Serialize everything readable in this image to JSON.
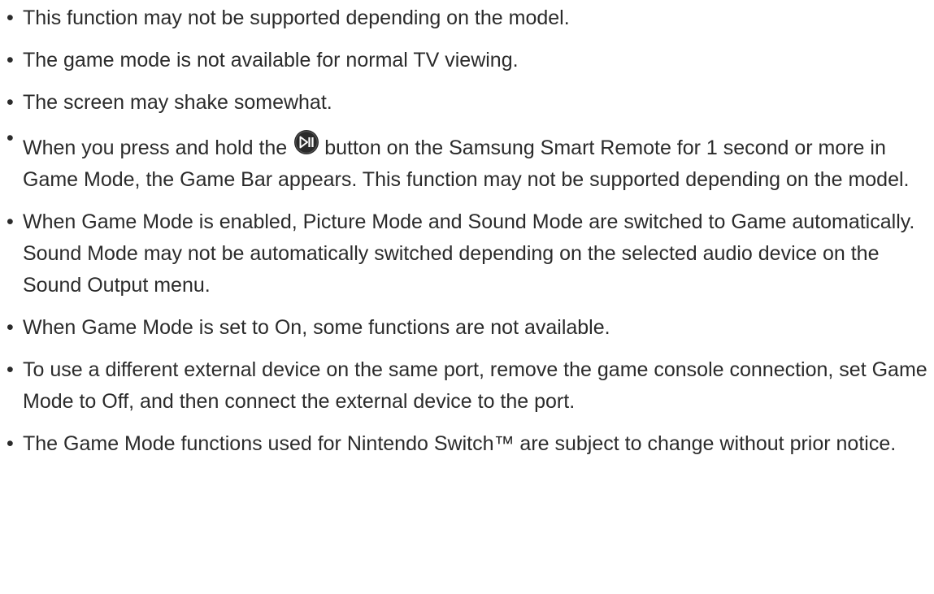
{
  "notes": [
    {
      "text": "This function may not be supported depending on the model."
    },
    {
      "text": "The game mode is not available for normal TV viewing."
    },
    {
      "text": "The screen may shake somewhat."
    },
    {
      "text_before_icon": "When you press and hold the",
      "icon": "play-pause-button-icon",
      "text_after_icon": "button on the Samsung Smart Remote for 1 second or more in Game Mode, the Game Bar appears. This function may not be supported depending on the model."
    },
    {
      "text": "When Game Mode is enabled, Picture Mode and Sound Mode are switched to Game automatically. Sound Mode may not be automatically switched depending on the selected audio device on the Sound Output menu."
    },
    {
      "text": "When Game Mode is set to On, some functions are not available."
    },
    {
      "text": "To use a different external device on the same port, remove the game console connection, set Game Mode to Off, and then connect the external device to the port."
    },
    {
      "text": "The Game Mode functions used for Nintendo Switch™ are subject to change without prior notice."
    }
  ],
  "bullet_glyph": "•",
  "colors": {
    "text": "#2b2b2b",
    "icon_fill": "#2a2a2a",
    "icon_glyph": "#ffffff"
  }
}
